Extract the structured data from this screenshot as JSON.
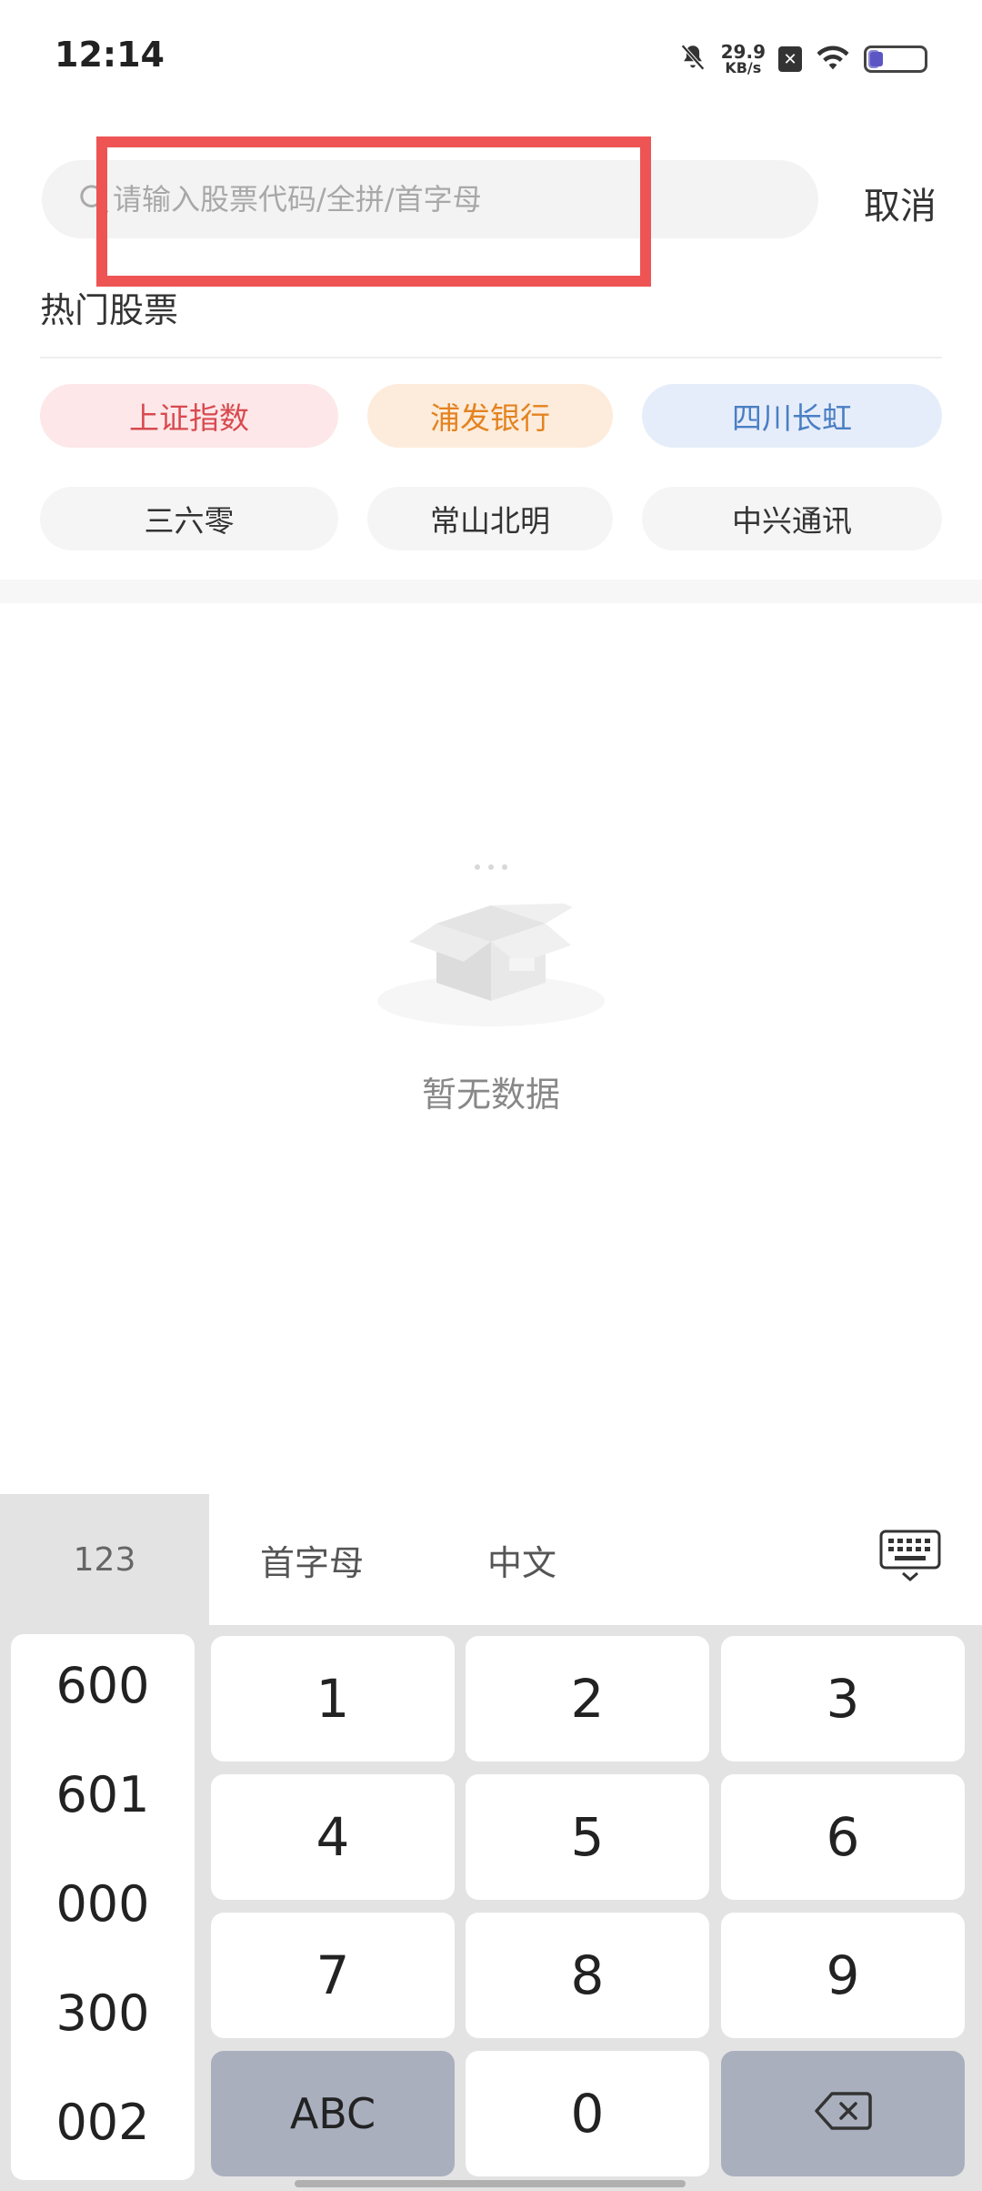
{
  "status_bar": {
    "time": "12:14",
    "net_speed_value": "29.9",
    "net_speed_unit": "KB/s",
    "battery_level": 0.2,
    "battery_color": "#8b87d6"
  },
  "search": {
    "placeholder": "请输入股票代码/全拼/首字母",
    "value": "",
    "cancel_label": "取消"
  },
  "hot_stocks": {
    "title": "热门股票",
    "items": [
      {
        "label": "上证指数",
        "color": "#d84a4f",
        "bg": "#fde7e9"
      },
      {
        "label": "浦发银行",
        "color": "#e48320",
        "bg": "#fdecdc"
      },
      {
        "label": "四川长虹",
        "color": "#4a7fc4",
        "bg": "#e6edfa"
      },
      {
        "label": "三六零",
        "color": "#333333",
        "bg": "#f5f5f5"
      },
      {
        "label": "常山北明",
        "color": "#333333",
        "bg": "#f5f5f5"
      },
      {
        "label": "中兴通讯",
        "color": "#333333",
        "bg": "#f5f5f5"
      }
    ]
  },
  "empty_state": {
    "text": "暂无数据",
    "icon": "empty-box-icon"
  },
  "keyboard": {
    "tabs": {
      "numeric": "123",
      "initials": "首字母",
      "chinese": "中文"
    },
    "prefixes": [
      "600",
      "601",
      "000",
      "300",
      "002"
    ],
    "keys": [
      "1",
      "2",
      "3",
      "4",
      "5",
      "6",
      "7",
      "8",
      "9"
    ],
    "abc_label": "ABC",
    "zero_label": "0"
  }
}
